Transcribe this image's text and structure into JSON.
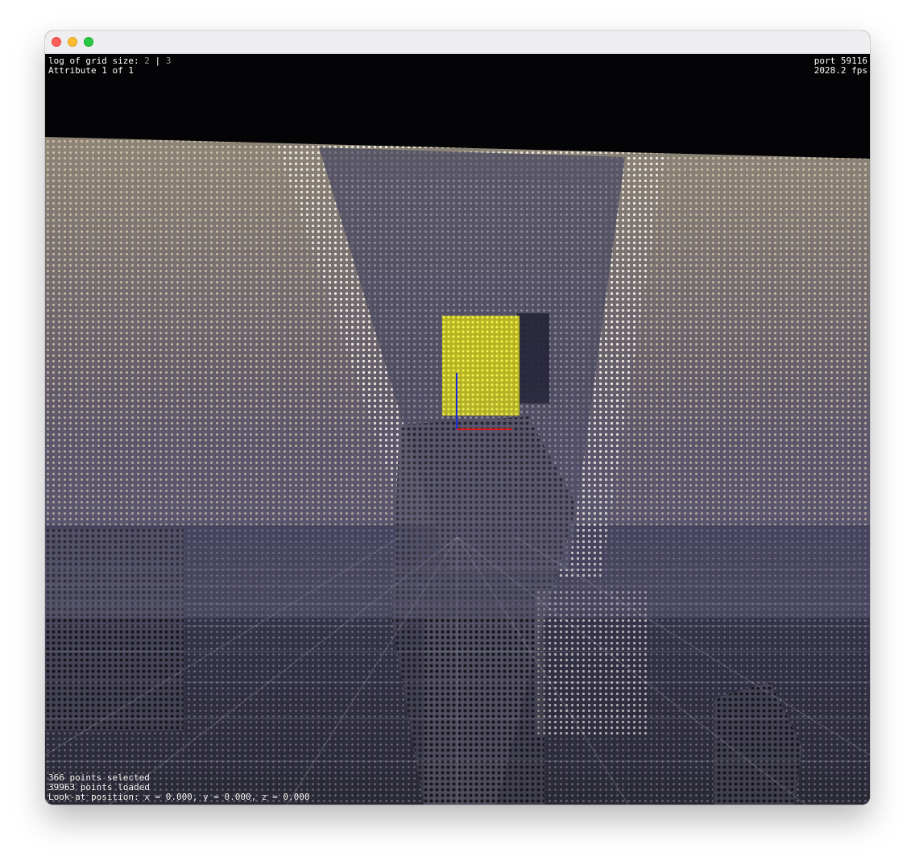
{
  "window": {
    "colors": {
      "close": "#fe5f57",
      "minimize": "#febc2e",
      "zoom": "#28c840",
      "titlebar": "#eeedf0"
    }
  },
  "hud": {
    "grid_label": "log of grid size: ",
    "grid_value_a": "2",
    "grid_sep": " | ",
    "grid_value_b": "3",
    "attribute_text": "Attribute 1 of 1",
    "port_text": "port 59116",
    "fps_text": "2028.2 fps",
    "selected_text": "366 points selected",
    "loaded_text": "39963 points loaded",
    "lookat_text": "Look-at position: x = 0.000, y = 0.000, z = 0.000"
  },
  "scene": {
    "background": "#040406",
    "selection_color": "#e4e23a",
    "axis_x_color": "#e01818",
    "axis_y_color": "#1a2ad8",
    "icons": [
      "point-cloud",
      "selection-box",
      "axis-gizmo",
      "floor-grid"
    ]
  }
}
